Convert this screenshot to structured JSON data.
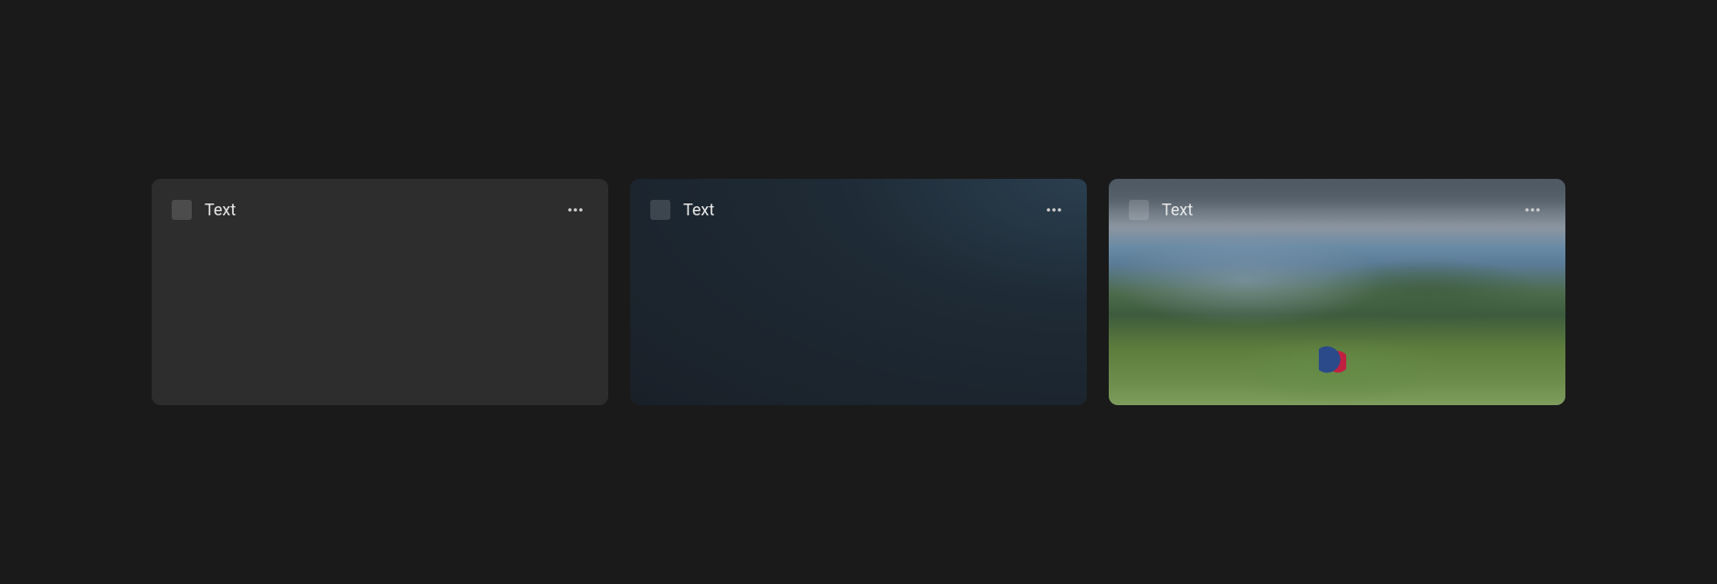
{
  "cards": [
    {
      "title": "Text",
      "variant": "solid",
      "icon": "placeholder-icon"
    },
    {
      "title": "Text",
      "variant": "gradient",
      "icon": "placeholder-icon"
    },
    {
      "title": "Text",
      "variant": "image",
      "icon": "placeholder-icon"
    }
  ],
  "colors": {
    "background": "#1a1a1a",
    "card_solid": "#2d2d2d",
    "text": "#e8e8e8"
  }
}
